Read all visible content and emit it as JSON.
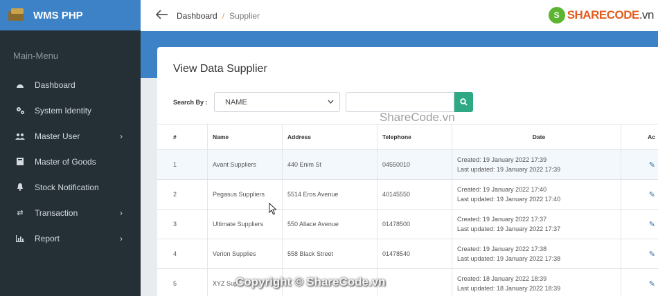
{
  "brand": {
    "title": "WMS PHP"
  },
  "sidebar": {
    "header": "Main-Menu",
    "items": [
      {
        "label": "Dashboard",
        "icon": "dashboard-icon",
        "has_submenu": false
      },
      {
        "label": "System Identity",
        "icon": "cogs-icon",
        "has_submenu": false
      },
      {
        "label": "Master User",
        "icon": "users-icon",
        "has_submenu": true
      },
      {
        "label": "Master of Goods",
        "icon": "box-icon",
        "has_submenu": false
      },
      {
        "label": "Stock Notification",
        "icon": "bell-icon",
        "has_submenu": false
      },
      {
        "label": "Transaction",
        "icon": "exchange-icon",
        "has_submenu": true
      },
      {
        "label": "Report",
        "icon": "chart-icon",
        "has_submenu": true
      }
    ]
  },
  "breadcrumb": {
    "home": "Dashboard",
    "separator": "/",
    "current": "Supplier"
  },
  "watermark": {
    "top_logo_text": "SHARECODE",
    "top_logo_suffix": ".vn",
    "mid": "ShareCode.vn",
    "bottom": "Copyright © ShareCode.vn"
  },
  "card": {
    "title": "View Data Supplier",
    "search_label": "Search By :",
    "search_select_value": "NAME",
    "search_input_value": ""
  },
  "table": {
    "headers": [
      "#",
      "Name",
      "Address",
      "Telephone",
      "Date",
      "Ac"
    ],
    "rows": [
      {
        "no": "1",
        "name": "Avant Suppliers",
        "address": "440 Enim St",
        "telephone": "04550010",
        "created": "Created: 19 January 2022 17:39",
        "updated": "Last updated: 19 January 2022 17:39"
      },
      {
        "no": "2",
        "name": "Pegasus Suppliers",
        "address": "5514 Eros Avenue",
        "telephone": "40145550",
        "created": "Created: 19 January 2022 17:40",
        "updated": "Last updated: 19 January 2022 17:40"
      },
      {
        "no": "3",
        "name": "Ultimate Suppliers",
        "address": "550 Allace Avenue",
        "telephone": "01478500",
        "created": "Created: 19 January 2022 17:37",
        "updated": "Last updated: 19 January 2022 17:37"
      },
      {
        "no": "4",
        "name": "Verion Supplies",
        "address": "558 Black Street",
        "telephone": "01478540",
        "created": "Created: 19 January 2022 17:38",
        "updated": "Last updated: 19 January 2022 17:38"
      },
      {
        "no": "5",
        "name": "XYZ Sup",
        "address": "",
        "telephone": "",
        "created": "Created: 18 January 2022 18:39",
        "updated": "Last updated: 18 January 2022 18:39"
      }
    ]
  },
  "colors": {
    "sidebar_bg": "#253036",
    "brand_bg": "#3d82c7",
    "search_button": "#2fa884"
  }
}
